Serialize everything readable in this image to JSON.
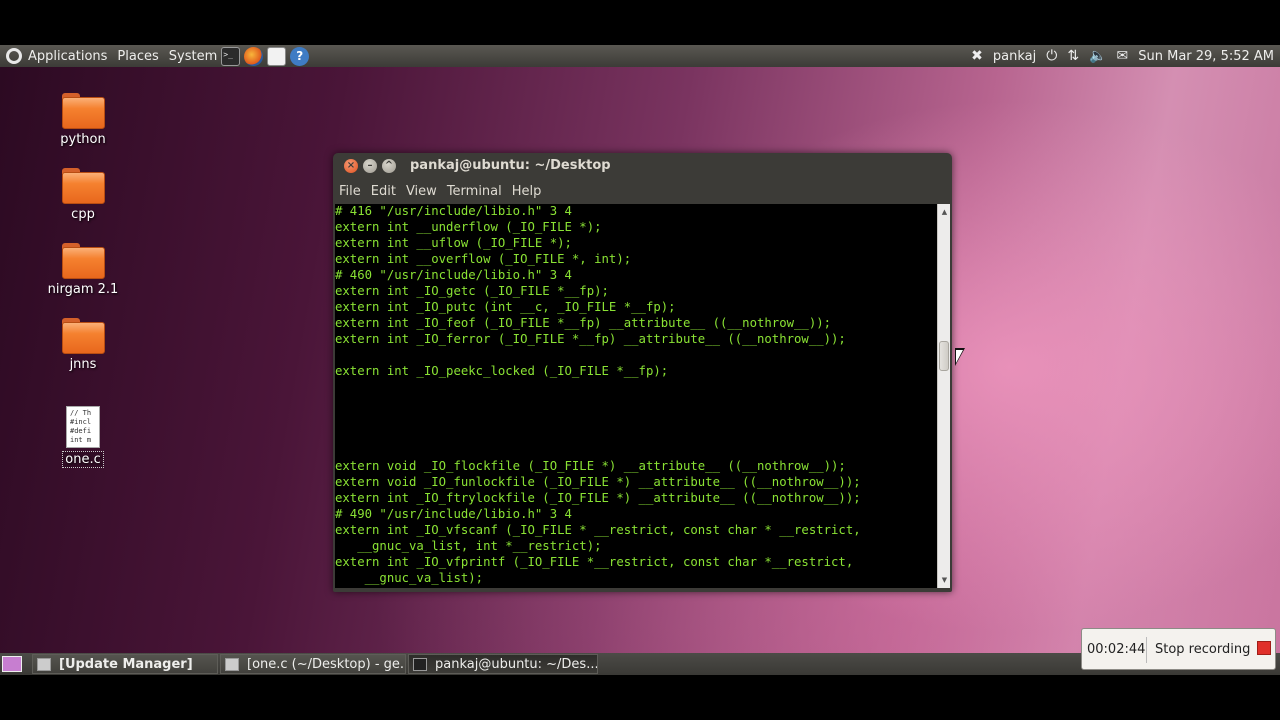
{
  "top_panel": {
    "menus": [
      "Applications",
      "Places",
      "System"
    ],
    "user": "pankaj",
    "clock": "Sun Mar 29,  5:52 AM"
  },
  "desktop_icons": [
    {
      "label": "python"
    },
    {
      "label": "cpp"
    },
    {
      "label": "nirgam 2.1"
    },
    {
      "label": "jnns"
    },
    {
      "label": "one.c",
      "preview": "// Th\n#incl\n#defi\nint m"
    }
  ],
  "terminal": {
    "title": "pankaj@ubuntu: ~/Desktop",
    "menu": [
      "File",
      "Edit",
      "View",
      "Terminal",
      "Help"
    ],
    "lines": [
      "# 416 \"/usr/include/libio.h\" 3 4",
      "extern int __underflow (_IO_FILE *);",
      "extern int __uflow (_IO_FILE *);",
      "extern int __overflow (_IO_FILE *, int);",
      "# 460 \"/usr/include/libio.h\" 3 4",
      "extern int _IO_getc (_IO_FILE *__fp);",
      "extern int _IO_putc (int __c, _IO_FILE *__fp);",
      "extern int _IO_feof (_IO_FILE *__fp) __attribute__ ((__nothrow__));",
      "extern int _IO_ferror (_IO_FILE *__fp) __attribute__ ((__nothrow__));",
      "",
      "extern int _IO_peekc_locked (_IO_FILE *__fp);",
      "",
      "",
      "",
      "",
      "",
      "extern void _IO_flockfile (_IO_FILE *) __attribute__ ((__nothrow__));",
      "extern void _IO_funlockfile (_IO_FILE *) __attribute__ ((__nothrow__));",
      "extern int _IO_ftrylockfile (_IO_FILE *) __attribute__ ((__nothrow__));",
      "# 490 \"/usr/include/libio.h\" 3 4",
      "extern int _IO_vfscanf (_IO_FILE * __restrict, const char * __restrict,",
      "   __gnuc_va_list, int *__restrict);",
      "extern int _IO_vfprintf (_IO_FILE *__restrict, const char *__restrict,",
      "    __gnuc_va_list);"
    ]
  },
  "taskbar": {
    "tasks": [
      {
        "label": "[Update Manager]"
      },
      {
        "label": "[one.c (~/Desktop) - ge..."
      },
      {
        "label": "pankaj@ubuntu: ~/Des..."
      }
    ]
  },
  "recorder": {
    "time": "00:02:44",
    "stop_label": "Stop recording"
  },
  "colors": {
    "terminal_text": "#8ae234",
    "panel": "#3c3b37",
    "accent_orange": "#f5812f"
  }
}
